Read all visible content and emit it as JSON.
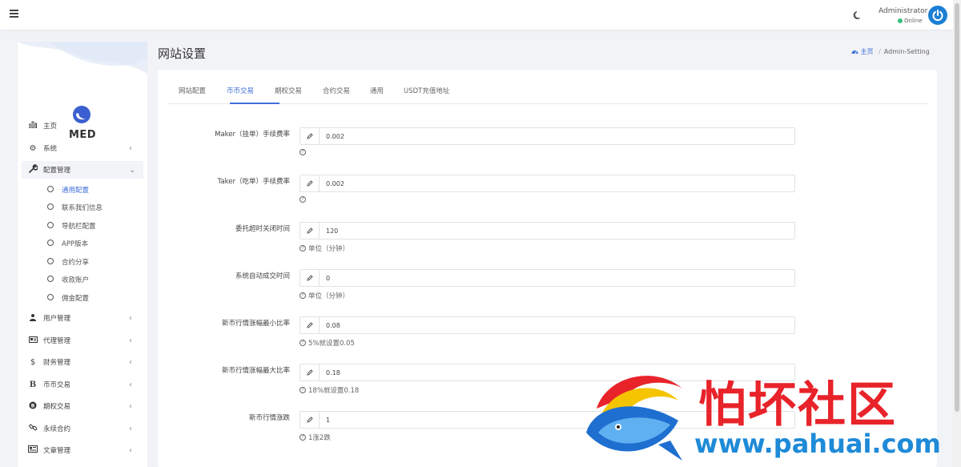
{
  "header": {
    "user_name": "Administrator",
    "user_status": "Online"
  },
  "sidebar": {
    "brand": "MED",
    "items": [
      {
        "label": "主页",
        "icon": "bar-chart-icon"
      },
      {
        "label": "系统",
        "icon": "gear-icon"
      },
      {
        "label": "配置管理",
        "icon": "wrench-icon"
      },
      {
        "label": "用户管理",
        "icon": "users-icon"
      },
      {
        "label": "代理管理",
        "icon": "id-card-icon"
      },
      {
        "label": "财务管理",
        "icon": "dollar-icon"
      },
      {
        "label": "币币交易",
        "icon": "bitcoin-icon"
      },
      {
        "label": "期权交易",
        "icon": "bitcoin-circle-icon"
      },
      {
        "label": "永续合约",
        "icon": "link-icon"
      },
      {
        "label": "文章管理",
        "icon": "newspaper-icon"
      }
    ],
    "sub_items": [
      {
        "label": "通用配置"
      },
      {
        "label": "联系我们信息"
      },
      {
        "label": "导航栏配置"
      },
      {
        "label": "APP版本"
      },
      {
        "label": "合约分享"
      },
      {
        "label": "收款账户"
      },
      {
        "label": "佣金配置"
      }
    ]
  },
  "page": {
    "title": "网站设置",
    "breadcrumb_home": "主页",
    "breadcrumb_current": "Admin-Setting"
  },
  "tabs": [
    {
      "label": "网站配置"
    },
    {
      "label": "币币交易"
    },
    {
      "label": "期权交易"
    },
    {
      "label": "合约交易"
    },
    {
      "label": "通用"
    },
    {
      "label": "USDT充值地址"
    }
  ],
  "fields": [
    {
      "label": "Maker（挂单）手续费率",
      "value": "0.002",
      "help": ""
    },
    {
      "label": "Taker（吃单）手续费率",
      "value": "0.002",
      "help": ""
    },
    {
      "label": "委托超时关闭时间",
      "value": "120",
      "help": "单位（分钟）"
    },
    {
      "label": "系统自动成交时间",
      "value": "0",
      "help": "单位（分钟）"
    },
    {
      "label": "新币行情涨幅最小比率",
      "value": "0.08",
      "help": "5%就设置0.05"
    },
    {
      "label": "新币行情涨幅最大比率",
      "value": "0.18",
      "help": "18%就设置0.18"
    },
    {
      "label": "新币行情涨跌",
      "value": "1",
      "help": "1涨2跌"
    }
  ],
  "watermark": {
    "title": "怕坏社区",
    "url": "www.pahuai.com"
  },
  "colors": {
    "accent": "#3f6fd8",
    "watermark_red": "#e8232a",
    "watermark_blue": "#1e8ad8"
  }
}
